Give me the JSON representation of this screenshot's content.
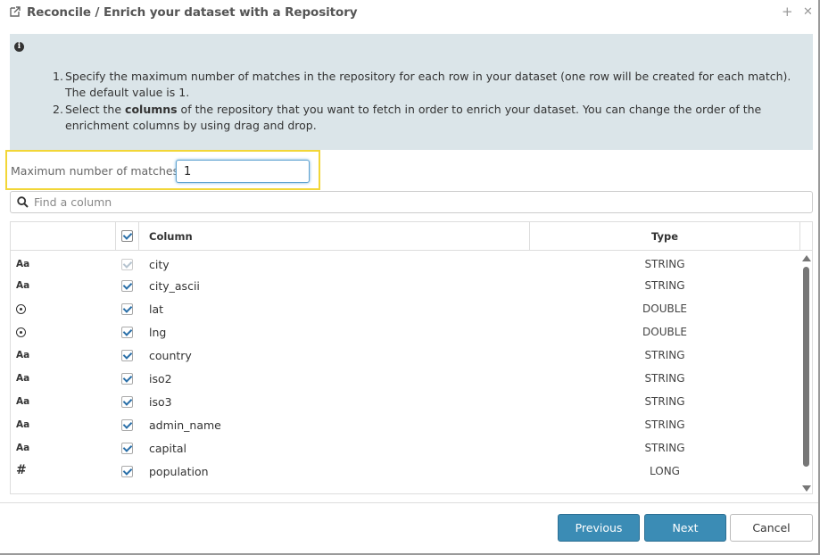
{
  "dialog": {
    "title": "Reconcile / Enrich your dataset with a Repository",
    "add_symbol": "+",
    "close_symbol": "✕"
  },
  "info": {
    "icon_text": "i",
    "steps": [
      {
        "num": "1.",
        "text_html_parts": [
          "Specify the maximum number of matches in the repository for each row in your dataset (one row will be created for each match). The default value is 1."
        ]
      },
      {
        "num": "2.",
        "pre": "Select the ",
        "bold": "columns",
        "post": " of the repository that you want to fetch in order to enrich your dataset. You can change the order of the enrichment columns by using drag and drop."
      }
    ]
  },
  "max_matches": {
    "label": "Maximum number of matches",
    "value": "1"
  },
  "search": {
    "placeholder": "Find a column"
  },
  "table": {
    "headers": {
      "column": "Column",
      "type": "Type"
    },
    "rows": [
      {
        "icon": "text-type-icon",
        "icon_text": "Aa",
        "name": "city",
        "type": "STRING",
        "checked": true,
        "disabled": true
      },
      {
        "icon": "text-type-icon",
        "icon_text": "Aa",
        "name": "city_ascii",
        "type": "STRING",
        "checked": true,
        "disabled": false
      },
      {
        "icon": "geo-type-icon",
        "icon_text": "",
        "name": "lat",
        "type": "DOUBLE",
        "checked": true,
        "disabled": false
      },
      {
        "icon": "geo-type-icon",
        "icon_text": "",
        "name": "lng",
        "type": "DOUBLE",
        "checked": true,
        "disabled": false
      },
      {
        "icon": "text-type-icon",
        "icon_text": "Aa",
        "name": "country",
        "type": "STRING",
        "checked": true,
        "disabled": false
      },
      {
        "icon": "text-type-icon",
        "icon_text": "Aa",
        "name": "iso2",
        "type": "STRING",
        "checked": true,
        "disabled": false
      },
      {
        "icon": "text-type-icon",
        "icon_text": "Aa",
        "name": "iso3",
        "type": "STRING",
        "checked": true,
        "disabled": false
      },
      {
        "icon": "text-type-icon",
        "icon_text": "Aa",
        "name": "admin_name",
        "type": "STRING",
        "checked": true,
        "disabled": false
      },
      {
        "icon": "text-type-icon",
        "icon_text": "Aa",
        "name": "capital",
        "type": "STRING",
        "checked": true,
        "disabled": false
      },
      {
        "icon": "number-type-icon",
        "icon_text": "#",
        "name": "population",
        "type": "LONG",
        "checked": true,
        "disabled": false
      }
    ]
  },
  "buttons": {
    "previous": "Previous",
    "next": "Next",
    "cancel": "Cancel"
  },
  "colors": {
    "primary": "#3b8cb5",
    "info_bg": "#dbe5e9",
    "highlight": "#f2d637"
  }
}
